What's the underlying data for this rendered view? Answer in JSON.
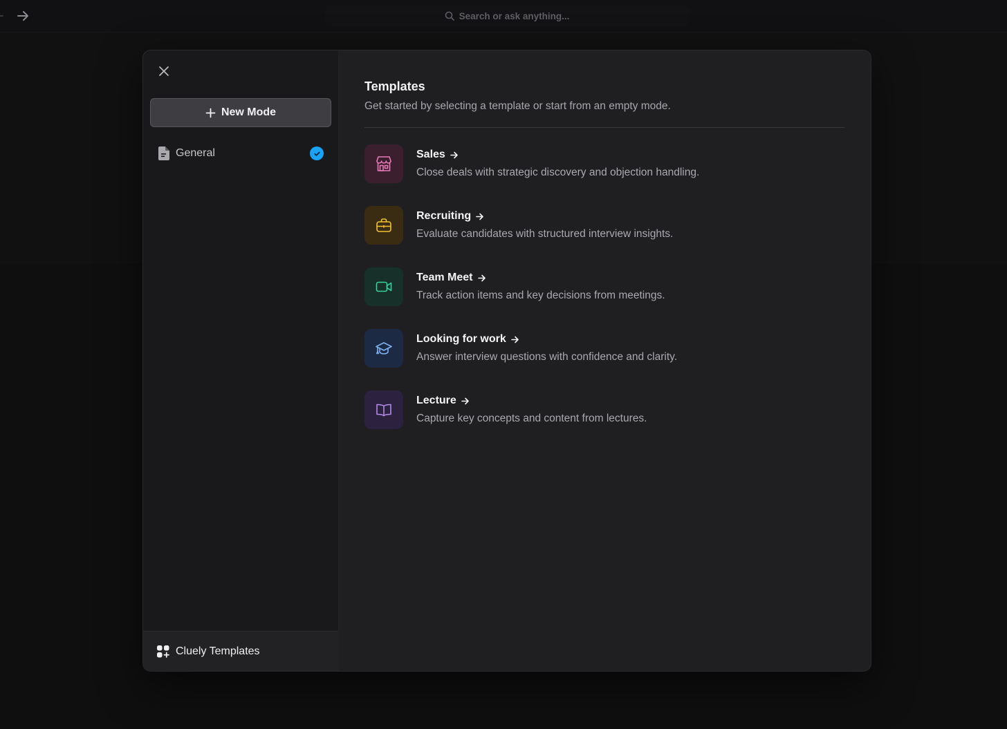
{
  "topbar": {
    "search_placeholder": "Search or ask anything..."
  },
  "sidebar": {
    "new_mode_label": "New Mode",
    "modes": [
      {
        "label": "General",
        "selected": true
      }
    ],
    "footer_label": "Cluely Templates"
  },
  "main": {
    "title": "Templates",
    "subtitle": "Get started by selecting a template or start from an empty mode.",
    "templates": [
      {
        "name": "Sales",
        "description": "Close deals with strategic discovery and objection handling.",
        "icon": "storefront-icon",
        "accent": "#e87ab8",
        "tile_bg": "#3b1f2e"
      },
      {
        "name": "Recruiting",
        "description": "Evaluate candidates with structured interview insights.",
        "icon": "briefcase-icon",
        "accent": "#f2c230",
        "tile_bg": "#3a2c12"
      },
      {
        "name": "Team Meet",
        "description": "Track action items and key decisions from meetings.",
        "icon": "video-camera-icon",
        "accent": "#35d49a",
        "tile_bg": "#17302a"
      },
      {
        "name": "Looking for work",
        "description": "Answer interview questions with confidence and clarity.",
        "icon": "graduation-cap-icon",
        "accent": "#7fb2f0",
        "tile_bg": "#1c2a44"
      },
      {
        "name": "Lecture",
        "description": "Capture key concepts and content from lectures.",
        "icon": "book-open-icon",
        "accent": "#b48ae8",
        "tile_bg": "#2d2140"
      }
    ]
  },
  "colors": {
    "check_badge": "#1aa3f5",
    "modal_bg": "#1f1f22",
    "sidebar_bg": "#19191b"
  }
}
